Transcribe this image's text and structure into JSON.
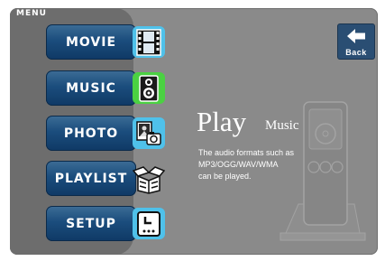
{
  "menu": {
    "label": "MENU",
    "items": [
      {
        "label": "MOVIE",
        "icon": "film-icon"
      },
      {
        "label": "MUSIC",
        "icon": "speaker-icon"
      },
      {
        "label": "PHOTO",
        "icon": "photo-icon"
      },
      {
        "label": "PLAYLIST",
        "icon": "open-box-icon"
      },
      {
        "label": "SETUP",
        "icon": "clock-icon"
      }
    ],
    "selected": "MUSIC"
  },
  "back_button": {
    "label": "Back",
    "icon": "back-arrow-icon"
  },
  "content": {
    "title_main": "Play",
    "title_sub": "Music",
    "description_lines": [
      "The audio formats such as",
      "MP3/OGG/WAV/WMA",
      "can be played."
    ]
  },
  "colors": {
    "background": "#8a8a8a",
    "menu_panel": "#6d6d6d",
    "button": "#1b4d7d",
    "icon_tile": "#4fc1ea",
    "icon_tile_selected": "#4bd142"
  }
}
